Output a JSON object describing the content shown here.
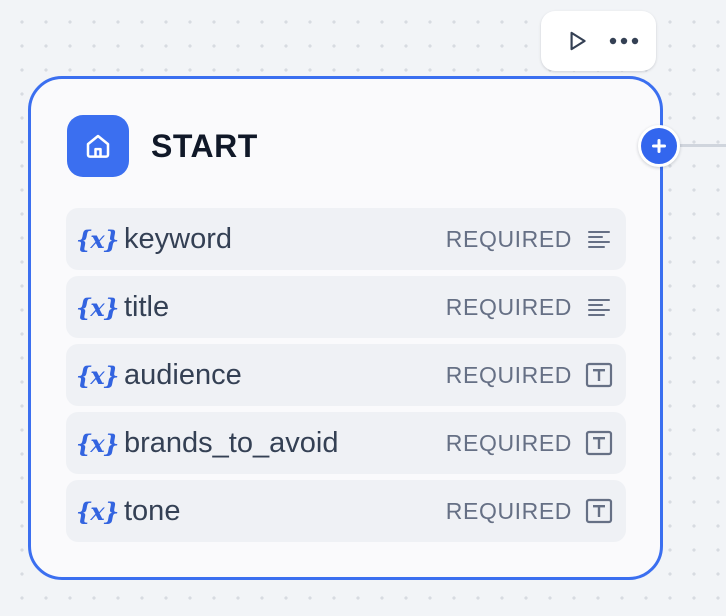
{
  "colors": {
    "accent": "#3b6ff0",
    "canvas": "#f2f4f7",
    "node_bg": "#fafafc",
    "row_bg": "#eff1f5",
    "variable_icon": "#3364e0"
  },
  "toolbar": {
    "run_icon": "play-icon",
    "more_icon": "more-horizontal-icon"
  },
  "node": {
    "title": "START",
    "icon": "home-icon",
    "add_handle_icon": "plus-icon"
  },
  "variables": [
    {
      "var_icon": "{x}",
      "name": "keyword",
      "status": "REQUIRED",
      "type_icon": "paragraph-icon"
    },
    {
      "var_icon": "{x}",
      "name": "title",
      "status": "REQUIRED",
      "type_icon": "paragraph-icon"
    },
    {
      "var_icon": "{x}",
      "name": "audience",
      "status": "REQUIRED",
      "type_icon": "text-input-icon"
    },
    {
      "var_icon": "{x}",
      "name": "brands_to_avoid",
      "status": "REQUIRED",
      "type_icon": "text-input-icon"
    },
    {
      "var_icon": "{x}",
      "name": "tone",
      "status": "REQUIRED",
      "type_icon": "text-input-icon"
    }
  ]
}
